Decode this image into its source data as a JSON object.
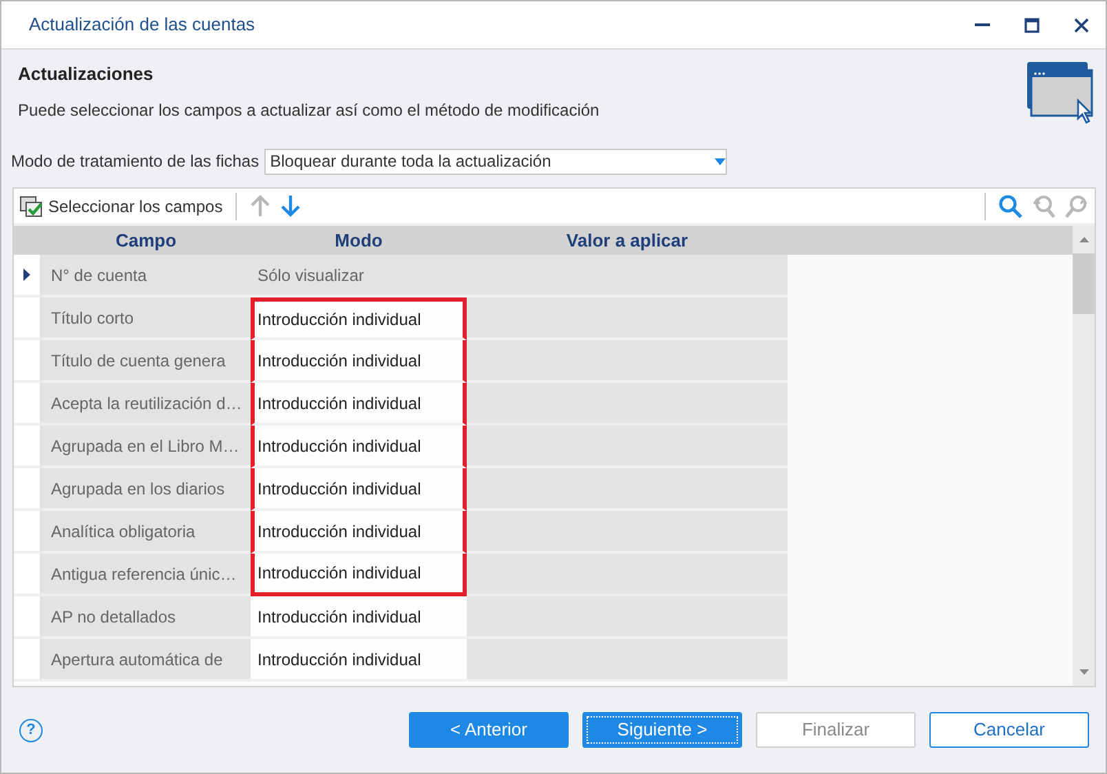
{
  "window": {
    "title": "Actualización de las cuentas"
  },
  "header": {
    "title": "Actualizaciones",
    "description": "Puede seleccionar los campos a actualizar así como el método de modificación"
  },
  "mode_select": {
    "label": "Modo de tratamiento de las fichas",
    "value": "Bloquear durante toda la actualización"
  },
  "toolbar": {
    "select_fields": "Seleccionar los campos",
    "icons": [
      {
        "kind": "up",
        "disabled": true
      },
      {
        "kind": "down",
        "disabled": false
      },
      {
        "kind": "search",
        "disabled": false
      },
      {
        "kind": "search-prev",
        "disabled": true
      },
      {
        "kind": "search-next",
        "disabled": true
      }
    ]
  },
  "table": {
    "columns": [
      "Campo",
      "Modo",
      "Valor a aplicar"
    ],
    "rows": [
      {
        "campo": "N° de cuenta",
        "modo": "Sólo visualizar",
        "selected": true,
        "editable": false,
        "highlighted": false
      },
      {
        "campo": "Título corto",
        "modo": "Introducción individual",
        "selected": false,
        "editable": true,
        "highlighted": true
      },
      {
        "campo": "Título de cuenta genera",
        "modo": "Introducción individual",
        "selected": false,
        "editable": true,
        "highlighted": true
      },
      {
        "campo": "Acepta la reutilización d…",
        "modo": "Introducción individual",
        "selected": false,
        "editable": true,
        "highlighted": true
      },
      {
        "campo": "Agrupada en el Libro M…",
        "modo": "Introducción individual",
        "selected": false,
        "editable": true,
        "highlighted": true
      },
      {
        "campo": "Agrupada en los diarios",
        "modo": "Introducción individual",
        "selected": false,
        "editable": true,
        "highlighted": true
      },
      {
        "campo": "Analítica obligatoria",
        "modo": "Introducción individual",
        "selected": false,
        "editable": true,
        "highlighted": true
      },
      {
        "campo": "Antigua referencia únic…",
        "modo": "Introducción individual",
        "selected": false,
        "editable": true,
        "highlighted": true
      },
      {
        "campo": "AP no detallados",
        "modo": "Introducción individual",
        "selected": false,
        "editable": true,
        "highlighted": false
      },
      {
        "campo": "Apertura automática de",
        "modo": "Introducción individual",
        "selected": false,
        "editable": true,
        "highlighted": false
      }
    ]
  },
  "help": {
    "label": "?"
  },
  "buttons": [
    {
      "label": "< Anterior",
      "kind": "primary",
      "disabled": false,
      "focused": false
    },
    {
      "label": "Siguiente >",
      "kind": "primary",
      "disabled": false,
      "focused": true
    },
    {
      "label": "Finalizar",
      "kind": "default",
      "disabled": true,
      "focused": false
    },
    {
      "label": "Cancelar",
      "kind": "default",
      "disabled": false,
      "focused": false
    }
  ]
}
